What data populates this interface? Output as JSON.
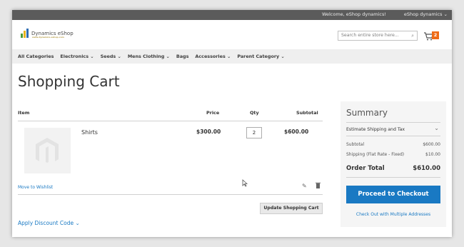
{
  "header": {
    "welcome": "Welcome, eShop dynamics!",
    "account": "eShop dynamics",
    "account_chevron": "⌄",
    "logo_text": "Dynamics eShop",
    "logo_tagline": "www.dynamics-eshop.com",
    "search_placeholder": "Search entire store here...",
    "search_icon": "⌕",
    "cart_icon": "🛒",
    "cart_count": "2"
  },
  "nav": {
    "items": [
      {
        "label": "All Categories"
      },
      {
        "label": "Electronics ⌄"
      },
      {
        "label": "Seeds ⌄"
      },
      {
        "label": "Mens Clothing ⌄"
      },
      {
        "label": "Bags"
      },
      {
        "label": "Accessories ⌄"
      },
      {
        "label": "Parent Category ⌄"
      }
    ]
  },
  "page": {
    "title": "Shopping Cart"
  },
  "cart": {
    "columns": {
      "item": "Item",
      "price": "Price",
      "qty": "Qty",
      "subtotal": "Subtotal"
    },
    "row": {
      "name": "Shirts",
      "price": "$300.00",
      "qty": "2",
      "subtotal": "$600.00"
    },
    "move_to_wishlist": "Move to Wishlist",
    "edit_icon": "✎",
    "delete_icon": "🗑",
    "update_button": "Update Shopping Cart",
    "discount_link": "Apply Discount Code ⌄"
  },
  "summary": {
    "title": "Summary",
    "estimate": "Estimate Shipping and Tax",
    "estimate_chevron": "⌄",
    "subtotal_label": "Subtotal",
    "subtotal_value": "$600.00",
    "shipping_label": "Shipping (Flat Rate - Fixed)",
    "shipping_value": "$10.00",
    "total_label": "Order Total",
    "total_value": "$610.00",
    "checkout_button": "Proceed to Checkout",
    "multi_link": "Check Out with Multiple Addresses"
  },
  "colors": {
    "primary": "#1979c3",
    "topbar": "#5b5b5b",
    "badge": "#ef6b17"
  }
}
